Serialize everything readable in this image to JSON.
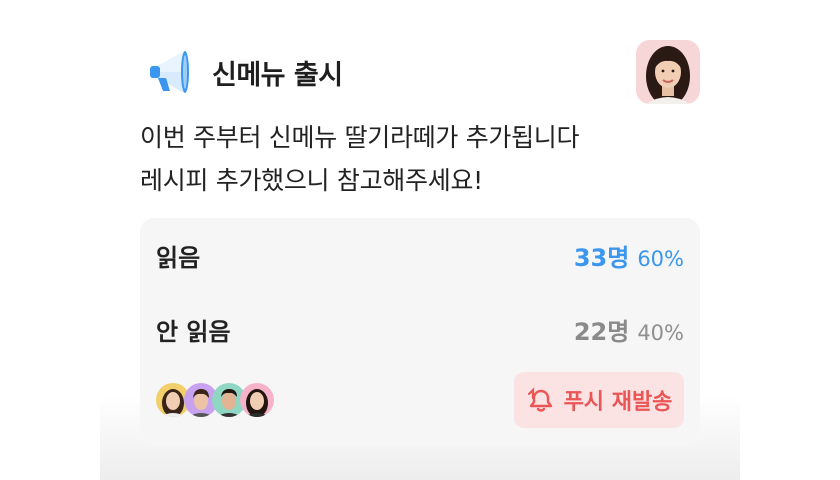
{
  "notice": {
    "icon": "megaphone-icon",
    "title": "신메뉴 출시",
    "message": "이번 주부터 신메뉴 딸기라떼가 추가됩니다\n레시피 추가했으니 참고해주세요!"
  },
  "stats": {
    "read": {
      "label": "읽음",
      "count": "33명",
      "percent": "60%"
    },
    "unread": {
      "label": "안 읽음",
      "count": "22명",
      "percent": "40%"
    },
    "push_button": {
      "label": "푸시 재발송",
      "icon": "push-resend-icon"
    }
  },
  "colors": {
    "accent": "#3a96ee",
    "push_text": "#ea5656",
    "push_bg": "#fbe3e3",
    "panel_bg": "#f6f6f6"
  }
}
